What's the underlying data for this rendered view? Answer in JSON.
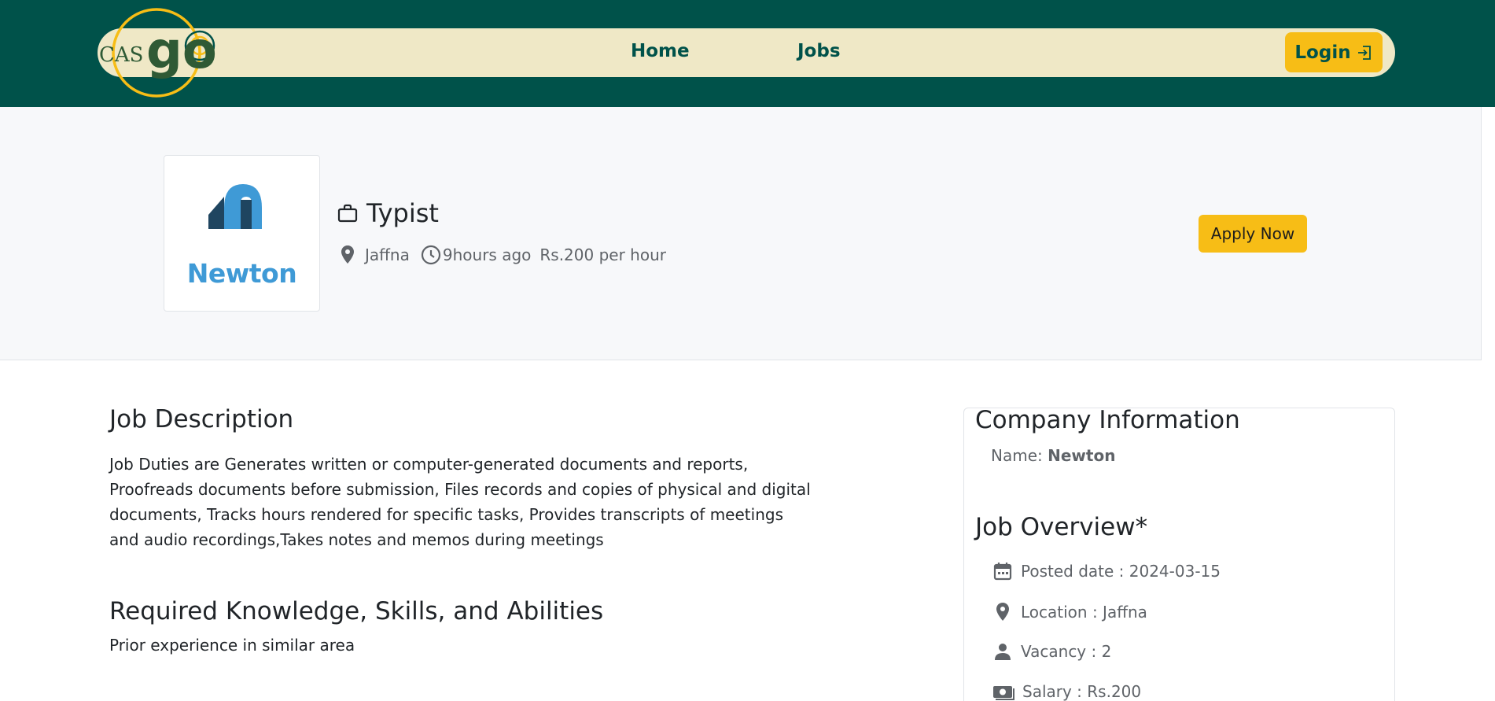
{
  "header": {
    "logo_text_prefix": "CAS",
    "logo_text_main": "go",
    "nav": [
      {
        "label": "Home"
      },
      {
        "label": "Jobs"
      }
    ],
    "login_label": "Login",
    "colors": {
      "primary": "#00524a",
      "pill": "#efe8c6",
      "accent": "#f7bd16"
    }
  },
  "job": {
    "company_logo_text": "Newton",
    "title": "Typist",
    "location": "Jaffna",
    "posted_ago": "9hours ago",
    "pay": "Rs.200 per hour",
    "apply_label": "Apply Now"
  },
  "description": {
    "heading": "Job Description",
    "text": "Job Duties are Generates written or computer-generated documents and reports, Proofreads documents before submission, Files records and copies of physical and digital documents, Tracks hours rendered for specific tasks, Provides transcripts of meetings and audio recordings,Takes notes and memos during meetings"
  },
  "skills": {
    "heading": "Required Knowledge, Skills, and Abilities",
    "text": "Prior experience in similar area"
  },
  "company_info": {
    "heading": "Company Information",
    "name_label": "Name:",
    "name_value": "Newton"
  },
  "overview": {
    "heading": "Job Overview*",
    "posted": "Posted date : 2024-03-15",
    "location": "Location : Jaffna",
    "vacancy": "Vacancy : 2",
    "salary": "Salary : Rs.200"
  }
}
